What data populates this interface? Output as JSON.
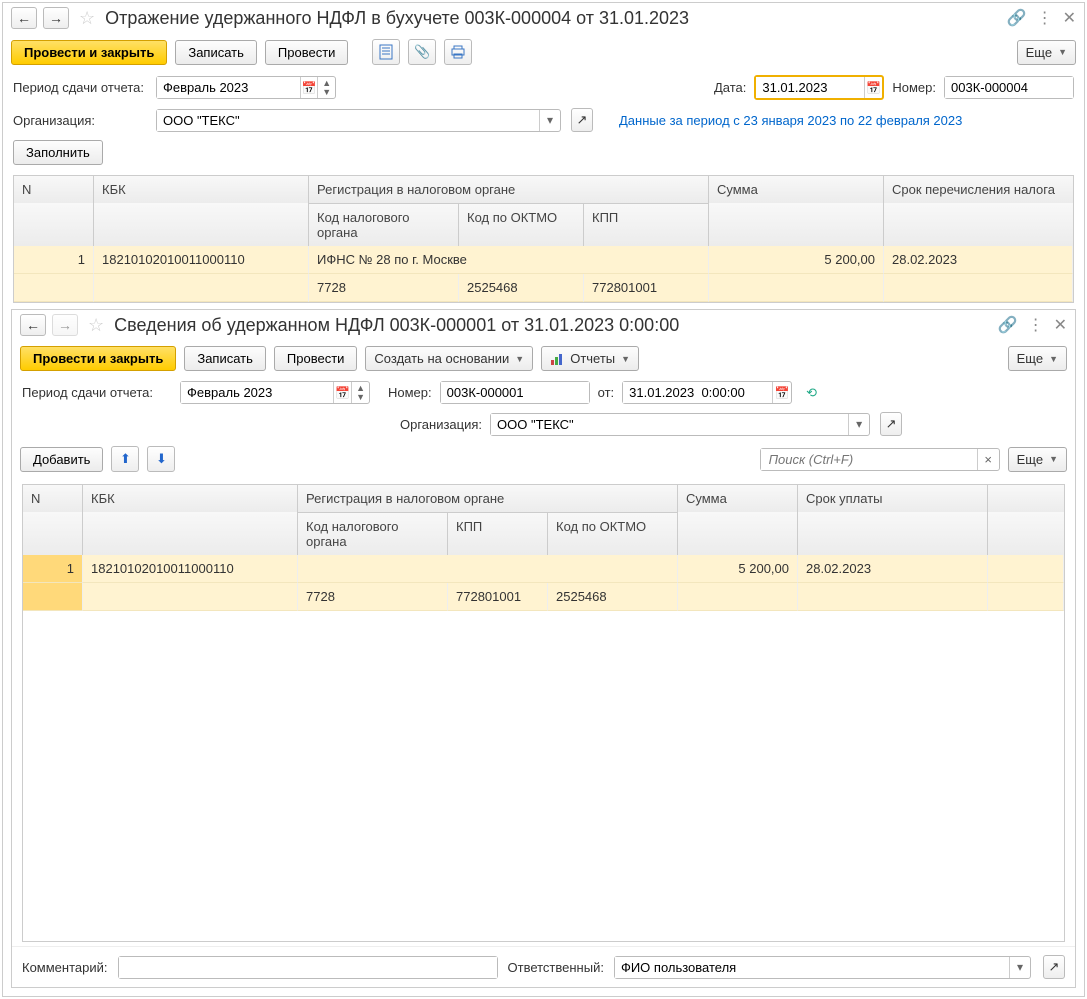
{
  "top": {
    "title": "Отражение удержанного НДФЛ в бухучете 003К-000004 от 31.01.2023",
    "btn_post_close": "Провести и закрыть",
    "btn_save": "Записать",
    "btn_post": "Провести",
    "btn_more": "Еще",
    "lbl_period": "Период сдачи отчета:",
    "period_value": "Февраль 2023",
    "lbl_date": "Дата:",
    "date_value": "31.01.2023",
    "lbl_number": "Номер:",
    "number_value": "003К-000004",
    "lbl_org": "Организация:",
    "org_value": "ООО \"ТЕКС\"",
    "period_info": "Данные за период с 23 января 2023 по 22 февраля 2023",
    "btn_fill": "Заполнить",
    "headers": {
      "n": "N",
      "kbk": "КБК",
      "reg": "Регистрация в налоговом органе",
      "code_org": "Код налогового органа",
      "oktmo": "Код по ОКТМО",
      "kpp": "КПП",
      "sum": "Сумма",
      "deadline": "Срок перечисления налога"
    },
    "row": {
      "n": "1",
      "kbk": "18210102010011000110",
      "reg_text": "ИФНС № 28 по  г. Москве",
      "code_org": "7728",
      "oktmo": "2525468",
      "kpp": "772801001",
      "sum": "5 200,00",
      "deadline": "28.02.2023"
    }
  },
  "sub": {
    "title": "Сведения об удержанном НДФЛ 003К-000001 от 31.01.2023 0:00:00",
    "btn_post_close": "Провести и закрыть",
    "btn_save": "Записать",
    "btn_post": "Провести",
    "btn_create_based": "Создать на основании",
    "btn_reports": "Отчеты",
    "btn_more": "Еще",
    "lbl_period": "Период сдачи отчета:",
    "period_value": "Февраль 2023",
    "lbl_number": "Номер:",
    "number_value": "003К-000001",
    "lbl_from": "от:",
    "from_value": "31.01.2023  0:00:00",
    "lbl_org": "Организация:",
    "org_value": "ООО \"ТЕКС\"",
    "btn_add": "Добавить",
    "search_placeholder": "Поиск (Ctrl+F)",
    "headers": {
      "n": "N",
      "kbk": "КБК",
      "reg": "Регистрация в налоговом органе",
      "code_org": "Код налогового органа",
      "kpp": "КПП",
      "oktmo": "Код по ОКТМО",
      "sum": "Сумма",
      "deadline": "Срок уплаты"
    },
    "row": {
      "n": "1",
      "kbk": "18210102010011000110",
      "code_org": "7728",
      "kpp": "772801001",
      "oktmo": "2525468",
      "sum": "5 200,00",
      "deadline": "28.02.2023"
    },
    "lbl_comment": "Комментарий:",
    "lbl_responsible": "Ответственный:",
    "responsible_value": "ФИО пользователя"
  }
}
